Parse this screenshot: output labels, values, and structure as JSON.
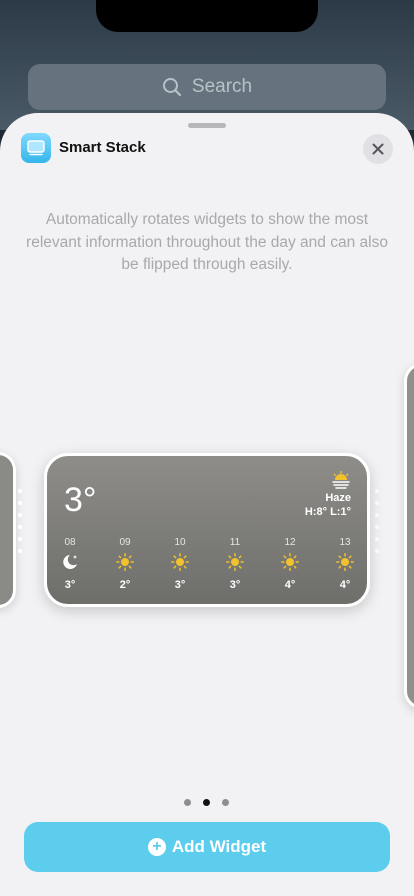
{
  "search": {
    "placeholder": "Search",
    "icon": "search-icon"
  },
  "sheet": {
    "app_title": "Smart Stack",
    "description": "Automatically rotates widgets to show the most relevant information throughout the day and can also be flipped through easily."
  },
  "widget": {
    "current_temp": "3°",
    "condition": "Haze",
    "hilo": "H:8° L:1°",
    "hours": [
      {
        "time": "08",
        "icon": "moon-icon",
        "temp": "3°"
      },
      {
        "time": "09",
        "icon": "sun-icon",
        "temp": "2°"
      },
      {
        "time": "10",
        "icon": "sun-icon",
        "temp": "3°"
      },
      {
        "time": "11",
        "icon": "sun-icon",
        "temp": "3°"
      },
      {
        "time": "12",
        "icon": "sun-icon",
        "temp": "4°"
      },
      {
        "time": "13",
        "icon": "sun-icon",
        "temp": "4°"
      }
    ]
  },
  "pager": {
    "pages": 3,
    "active": 2
  },
  "add_button": {
    "label": "Add Widget"
  },
  "colors": {
    "accent": "#5ccdec",
    "sun": "#f2c12e"
  }
}
